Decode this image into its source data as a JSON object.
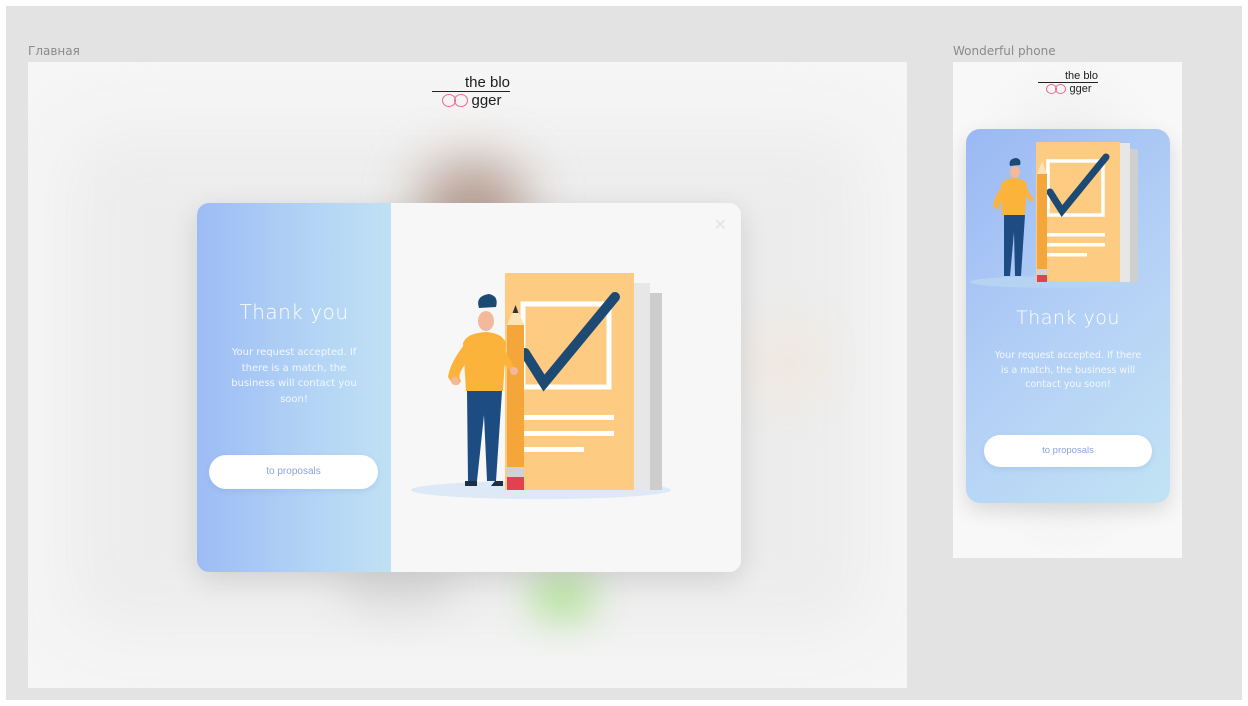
{
  "canvas": {
    "frames": [
      {
        "label": "Главная"
      },
      {
        "label": "Wonderful phone"
      }
    ]
  },
  "logo": {
    "line1": "the blo",
    "line2": "gger",
    "loop_color": "#e86a98"
  },
  "modal": {
    "title": "Thank you",
    "message": "Your request accepted. If there is a match, the business will contact you soon!",
    "button_label": "to proposals",
    "close_icon": "close-icon",
    "illustration": "person-with-checklist-illustration"
  },
  "phone": {
    "title": "Thank you",
    "message": "Your request accepted. If there is a match, the business will contact you soon!",
    "button_label": "to proposals"
  },
  "colors": {
    "canvas_bg": "#e3e3e3",
    "gradient_start": "#9dbcf5",
    "gradient_end": "#c0e1f3",
    "button_text": "#89a4dc",
    "document": "#fdcb82",
    "check": "#1d4a73",
    "shirt": "#fcb33b",
    "pants": "#1c4c82"
  }
}
